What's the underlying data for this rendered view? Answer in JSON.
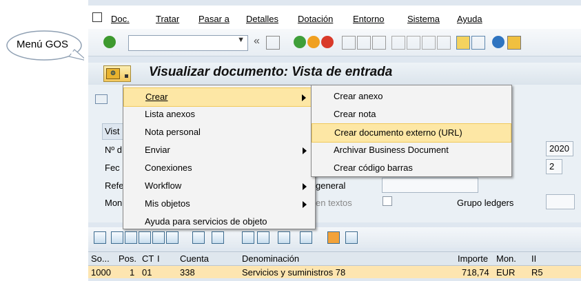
{
  "callout": {
    "label": "Menú GOS"
  },
  "menubar": {
    "items": [
      "Doc.",
      "Tratar",
      "Pasar a",
      "Detalles",
      "Dotación",
      "Entorno",
      "Sistema",
      "Ayuda"
    ]
  },
  "toolbar": {
    "command_value": "",
    "back_label": "«"
  },
  "title": {
    "text": "Visualizar documento: Vista de entrada"
  },
  "tabs": {
    "first": "Vist"
  },
  "fields": {
    "labels": [
      "Nº d",
      "Fec",
      "Refe",
      "Mon"
    ],
    "ledger_general": "general",
    "en_textos": "en textos",
    "grupo_ledgers": "Grupo ledgers",
    "year": "2020",
    "period": "2"
  },
  "menu": {
    "items": [
      {
        "label": "Crear",
        "submenu": true,
        "selected": true
      },
      {
        "label": "Lista anexos",
        "submenu": false
      },
      {
        "label": "Nota personal",
        "submenu": false
      },
      {
        "label": "Enviar",
        "submenu": true
      },
      {
        "label": "Conexiones",
        "submenu": false
      },
      {
        "label": "Workflow",
        "submenu": true
      },
      {
        "label": "Mis objetos",
        "submenu": true
      },
      {
        "label": "Ayuda para servicios de objeto",
        "submenu": false
      }
    ]
  },
  "submenu": {
    "items": [
      {
        "label": "Crear anexo"
      },
      {
        "label": "Crear nota"
      },
      {
        "label": "Crear documento externo (URL)",
        "selected": true
      },
      {
        "label": "Archivar Business Document"
      },
      {
        "label": "Crear código barras"
      }
    ]
  },
  "grid": {
    "headers": [
      "So...",
      "Pos.",
      "CT",
      "I",
      "Cuenta",
      "Denominación",
      "Importe",
      "Mon.",
      "II"
    ],
    "rows": [
      [
        "1000",
        "1",
        "01",
        "",
        "338",
        "Servicios y suministros 78",
        "718,74",
        "EUR",
        "R5"
      ]
    ]
  },
  "colors": {
    "highlight": "#fde7a5",
    "row_selected": "#fde5b0",
    "title_bar": "#dbe4ec"
  }
}
